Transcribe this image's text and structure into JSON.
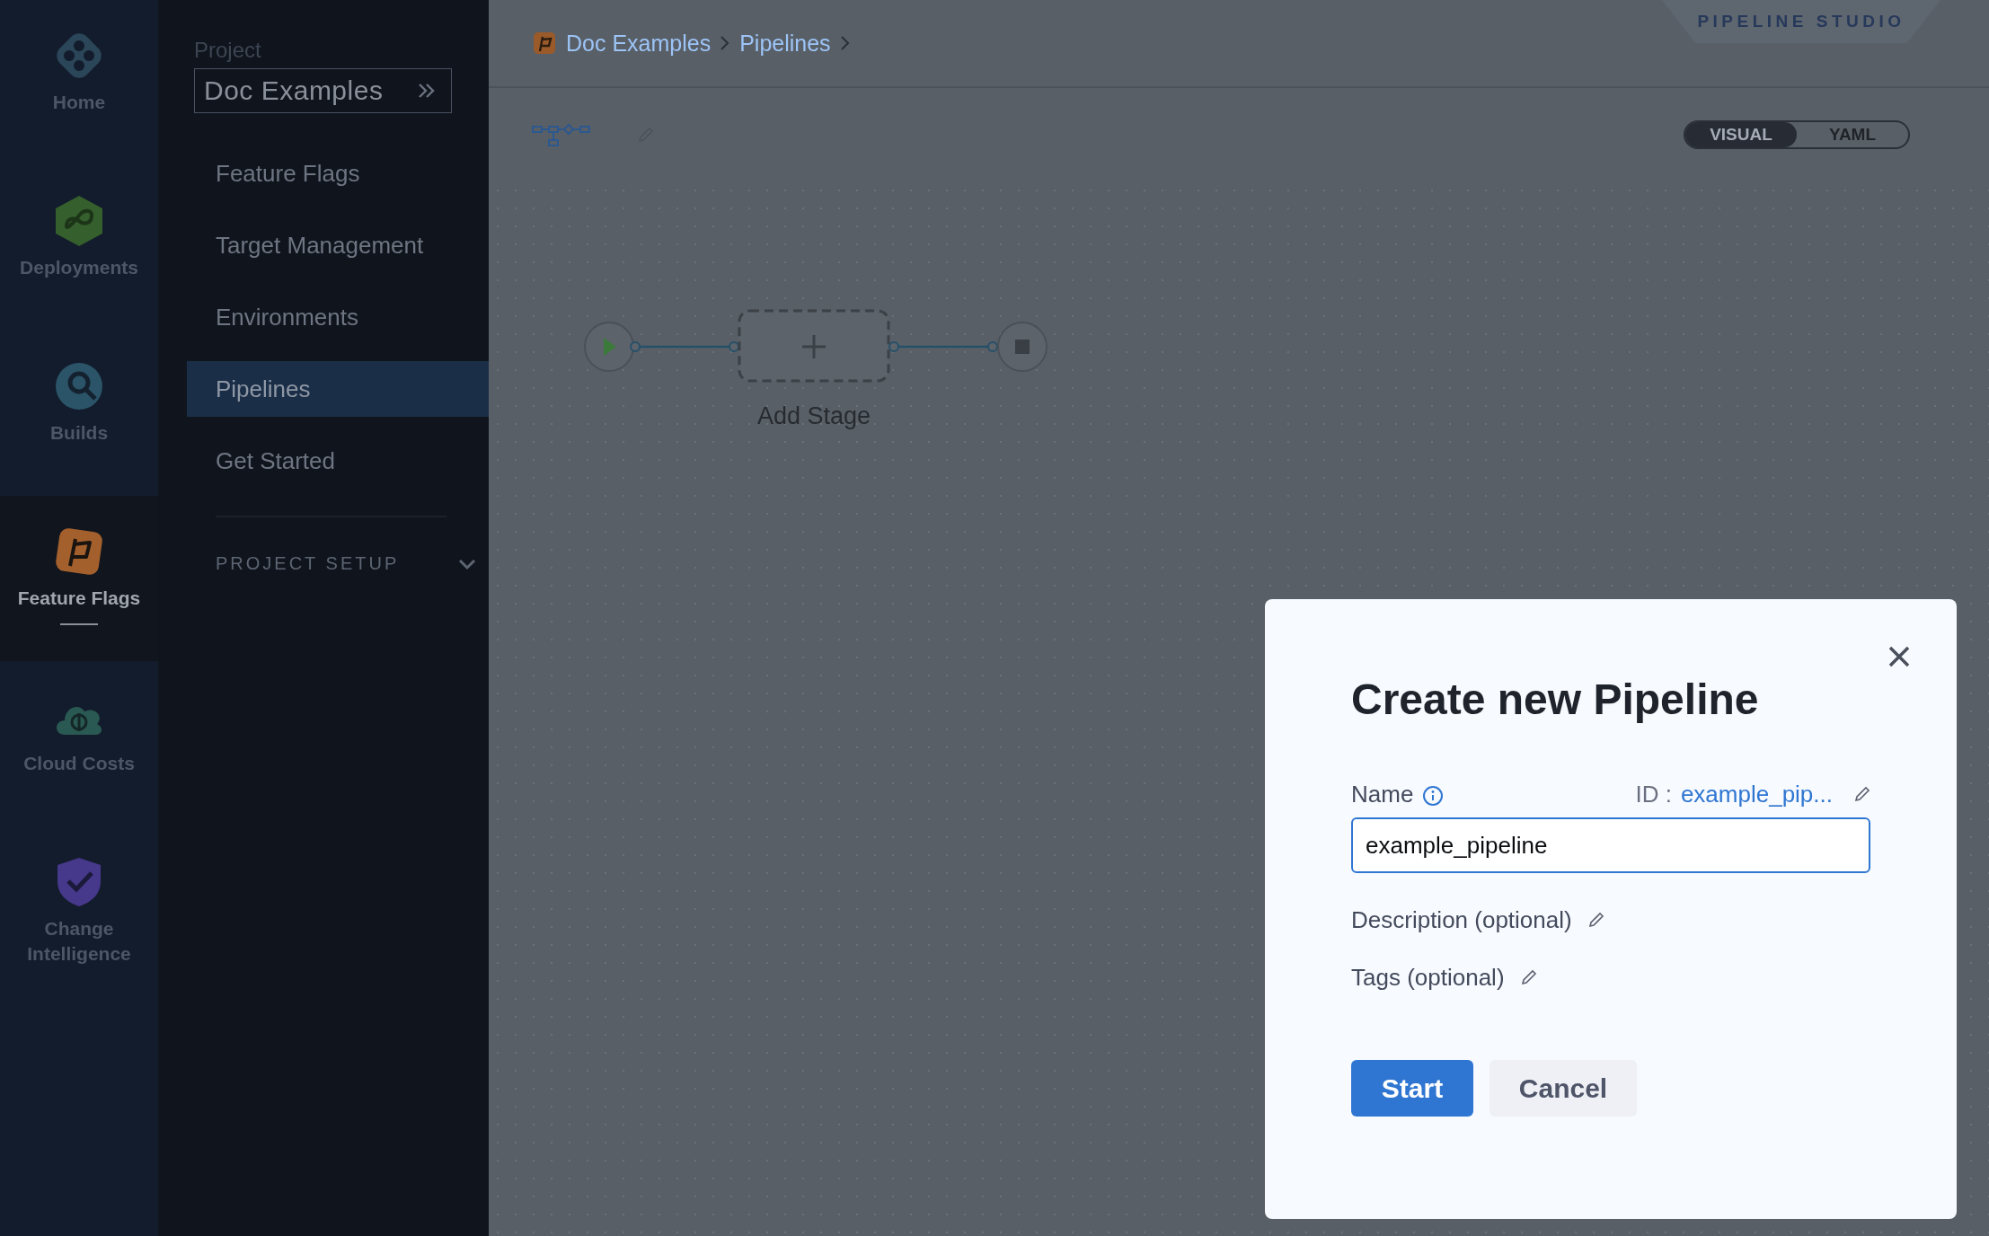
{
  "module_nav": {
    "items": [
      {
        "label": "Home",
        "selected": false
      },
      {
        "label": "Deployments",
        "selected": false
      },
      {
        "label": "Builds",
        "selected": false
      },
      {
        "label": "Feature Flags",
        "selected": true
      },
      {
        "label": "Cloud Costs",
        "selected": false
      },
      {
        "label": "Change Intelligence",
        "selected": false
      }
    ]
  },
  "project_nav": {
    "caption": "Project",
    "project": "Doc Examples",
    "items": [
      {
        "label": "Feature Flags",
        "selected": false
      },
      {
        "label": "Target Management",
        "selected": false
      },
      {
        "label": "Environments",
        "selected": false
      },
      {
        "label": "Pipelines",
        "selected": true
      },
      {
        "label": "Get Started",
        "selected": false
      }
    ],
    "section": {
      "label": "PROJECT SETUP",
      "expanded": false
    }
  },
  "breadcrumbs": [
    "Doc Examples",
    "Pipelines"
  ],
  "studio_tab": "PIPELINE STUDIO",
  "view_toggle": [
    {
      "label": "VISUAL",
      "selected": true
    },
    {
      "label": "YAML",
      "selected": false
    }
  ],
  "canvas": {
    "add_stage_label": "Add Stage"
  },
  "dialog": {
    "title": "Create new Pipeline",
    "name_label": "Name",
    "id_label": "ID :",
    "id_value": "example_pip...",
    "name_value": "example_pipeline",
    "description_label": "Description (optional)",
    "tags_label": "Tags (optional)",
    "buttons": [
      {
        "label": "Start",
        "kind": "primary"
      },
      {
        "label": "Cancel",
        "kind": "secondary"
      }
    ]
  }
}
